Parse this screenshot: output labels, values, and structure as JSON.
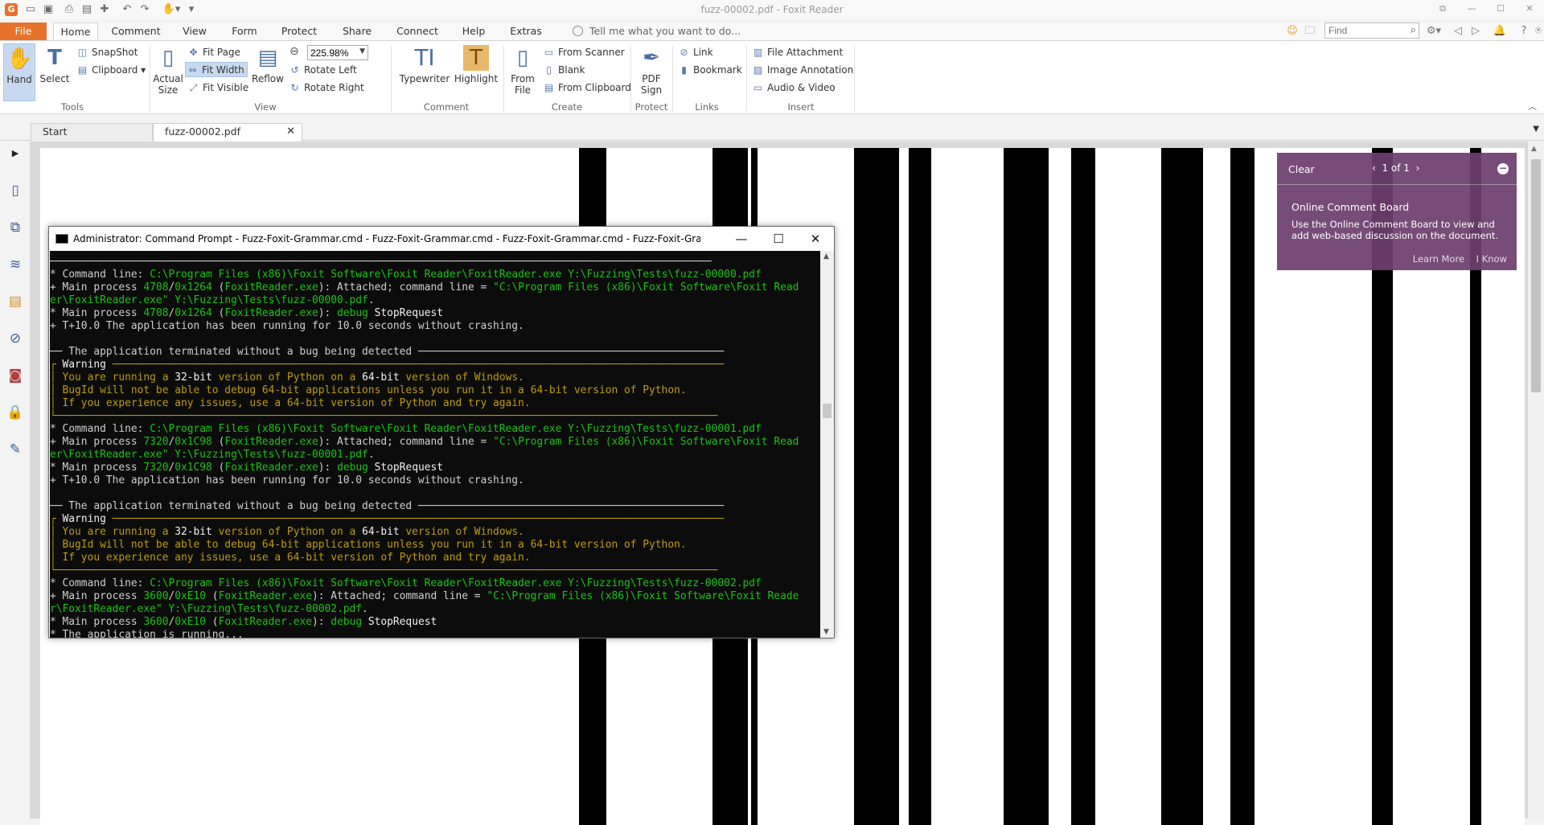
{
  "window": {
    "title": "fuzz-00002.pdf - Foxit Reader",
    "app_logo": "G"
  },
  "menu": {
    "tabs": [
      "File",
      "Home",
      "Comment",
      "View",
      "Form",
      "Protect",
      "Share",
      "Connect",
      "Help",
      "Extras"
    ],
    "tell_me": "Tell me what you want to do...",
    "find_placeholder": "Find"
  },
  "ribbon": {
    "tools": {
      "hand": "Hand",
      "select": "Select",
      "snapshot": "SnapShot",
      "clipboard": "Clipboard",
      "label": "Tools"
    },
    "view": {
      "actual_size_1": "Actual",
      "actual_size_2": "Size",
      "fit_page": "Fit Page",
      "fit_width": "Fit Width",
      "fit_visible": "Fit Visible",
      "reflow": "Reflow",
      "zoom": "225.98%",
      "rotate_left": "Rotate Left",
      "rotate_right": "Rotate Right",
      "label": "View"
    },
    "comment": {
      "typewriter": "Typewriter",
      "highlight": "Highlight",
      "label": "Comment"
    },
    "create": {
      "from_file_1": "From",
      "from_file_2": "File",
      "from_scanner": "From Scanner",
      "blank": "Blank",
      "from_clipboard": "From Clipboard",
      "label": "Create"
    },
    "protect": {
      "pdf_sign_1": "PDF",
      "pdf_sign_2": "Sign",
      "label": "Protect"
    },
    "links": {
      "link": "Link",
      "bookmark": "Bookmark",
      "label": "Links"
    },
    "insert": {
      "file_attachment": "File Attachment",
      "image_annotation": "Image Annotation",
      "audio_video": "Audio & Video",
      "label": "Insert"
    }
  },
  "doc_tabs": [
    "Start",
    "fuzz-00002.pdf"
  ],
  "comment_board": {
    "clear": "Clear",
    "pager": "1 of 1",
    "heading": "Online Comment Board",
    "body": "Use the Online Comment Board to view and add web-based discussion on the document.",
    "learn_more": "Learn More",
    "i_know": "I Know"
  },
  "cmd": {
    "title": "Administrator: Command Prompt - Fuzz-Foxit-Grammar.cmd - Fuzz-Foxit-Grammar.cmd - Fuzz-Foxit-Grammar.cmd - Fuzz-Foxit-Grammar.cmd - Fuzz...",
    "lines": [
      [
        {
          "c": "rule",
          "t": "──────────────────────────────────────────────────────────────────────────────────────────────────────────"
        }
      ],
      [
        {
          "c": "",
          "t": "* Command line: "
        },
        {
          "c": "gr",
          "t": "C:\\Program Files (x86)\\Foxit Software\\Foxit Reader\\FoxitReader.exe Y:\\Fuzzing\\Tests\\fuzz-00000.pdf"
        }
      ],
      [
        {
          "c": "",
          "t": "+ Main process "
        },
        {
          "c": "gr",
          "t": "4708"
        },
        {
          "c": "",
          "t": "/"
        },
        {
          "c": "gr",
          "t": "0x1264"
        },
        {
          "c": "",
          "t": " ("
        },
        {
          "c": "gr",
          "t": "FoxitReader.exe"
        },
        {
          "c": "",
          "t": "): Attached; command line = "
        },
        {
          "c": "gr",
          "t": "\"C:\\Program Files (x86)\\Foxit Software\\Foxit Read"
        }
      ],
      [
        {
          "c": "gr",
          "t": "er\\FoxitReader.exe\" Y:\\Fuzzing\\Tests\\fuzz-00000.pdf"
        },
        {
          "c": "",
          "t": "."
        }
      ],
      [
        {
          "c": "",
          "t": "* Main process "
        },
        {
          "c": "gr",
          "t": "4708"
        },
        {
          "c": "",
          "t": "/"
        },
        {
          "c": "gr",
          "t": "0x1264"
        },
        {
          "c": "",
          "t": " ("
        },
        {
          "c": "gr",
          "t": "FoxitReader.exe"
        },
        {
          "c": "",
          "t": "): "
        },
        {
          "c": "gr",
          "t": "debug"
        },
        {
          "c": "wh",
          "t": " StopRequest"
        }
      ],
      [
        {
          "c": "",
          "t": "+ T+10.0 The application has been running for 10.0 seconds without crashing."
        }
      ],
      [
        {
          "c": "",
          "t": ""
        }
      ],
      [
        {
          "c": "",
          "t": "── The application terminated without a bug being detected ─────────────────────────────────────────────────"
        }
      ],
      [
        {
          "c": "yl",
          "t": "┌ "
        },
        {
          "c": "wh",
          "t": "Warning"
        },
        {
          "c": "yl",
          "t": " ──────────────────────────────────────────────────────────────────────────────────────────────────"
        }
      ],
      [
        {
          "c": "yl",
          "t": "│ You are running a "
        },
        {
          "c": "wh",
          "t": "32-bit"
        },
        {
          "c": "yl",
          "t": " version of Python on a "
        },
        {
          "c": "wh",
          "t": "64-bit"
        },
        {
          "c": "yl",
          "t": " version of Windows."
        }
      ],
      [
        {
          "c": "yl",
          "t": "│ BugId will not be able to debug 64-bit applications unless you run it in a 64-bit version of Python."
        }
      ],
      [
        {
          "c": "yl",
          "t": "│ If you experience any issues, use a 64-bit version of Python and try again."
        }
      ],
      [
        {
          "c": "yl",
          "t": "└──────────────────────────────────────────────────────────────────────────────────────────────────────────"
        }
      ],
      [
        {
          "c": "",
          "t": "* Command line: "
        },
        {
          "c": "gr",
          "t": "C:\\Program Files (x86)\\Foxit Software\\Foxit Reader\\FoxitReader.exe Y:\\Fuzzing\\Tests\\fuzz-00001.pdf"
        }
      ],
      [
        {
          "c": "",
          "t": "+ Main process "
        },
        {
          "c": "gr",
          "t": "7320"
        },
        {
          "c": "",
          "t": "/"
        },
        {
          "c": "gr",
          "t": "0x1C98"
        },
        {
          "c": "",
          "t": " ("
        },
        {
          "c": "gr",
          "t": "FoxitReader.exe"
        },
        {
          "c": "",
          "t": "): Attached; command line = "
        },
        {
          "c": "gr",
          "t": "\"C:\\Program Files (x86)\\Foxit Software\\Foxit Read"
        }
      ],
      [
        {
          "c": "gr",
          "t": "er\\FoxitReader.exe\" Y:\\Fuzzing\\Tests\\fuzz-00001.pdf"
        },
        {
          "c": "",
          "t": "."
        }
      ],
      [
        {
          "c": "",
          "t": "* Main process "
        },
        {
          "c": "gr",
          "t": "7320"
        },
        {
          "c": "",
          "t": "/"
        },
        {
          "c": "gr",
          "t": "0x1C98"
        },
        {
          "c": "",
          "t": " ("
        },
        {
          "c": "gr",
          "t": "FoxitReader.exe"
        },
        {
          "c": "",
          "t": "): "
        },
        {
          "c": "gr",
          "t": "debug"
        },
        {
          "c": "wh",
          "t": " StopRequest"
        }
      ],
      [
        {
          "c": "",
          "t": "+ T+10.0 The application has been running for 10.0 seconds without crashing."
        }
      ],
      [
        {
          "c": "",
          "t": ""
        }
      ],
      [
        {
          "c": "",
          "t": "── The application terminated without a bug being detected ─────────────────────────────────────────────────"
        }
      ],
      [
        {
          "c": "yl",
          "t": "┌ "
        },
        {
          "c": "wh",
          "t": "Warning"
        },
        {
          "c": "yl",
          "t": " ──────────────────────────────────────────────────────────────────────────────────────────────────"
        }
      ],
      [
        {
          "c": "yl",
          "t": "│ You are running a "
        },
        {
          "c": "wh",
          "t": "32-bit"
        },
        {
          "c": "yl",
          "t": " version of Python on a "
        },
        {
          "c": "wh",
          "t": "64-bit"
        },
        {
          "c": "yl",
          "t": " version of Windows."
        }
      ],
      [
        {
          "c": "yl",
          "t": "│ BugId will not be able to debug 64-bit applications unless you run it in a 64-bit version of Python."
        }
      ],
      [
        {
          "c": "yl",
          "t": "│ If you experience any issues, use a 64-bit version of Python and try again."
        }
      ],
      [
        {
          "c": "yl",
          "t": "└──────────────────────────────────────────────────────────────────────────────────────────────────────────"
        }
      ],
      [
        {
          "c": "",
          "t": "* Command line: "
        },
        {
          "c": "gr",
          "t": "C:\\Program Files (x86)\\Foxit Software\\Foxit Reader\\FoxitReader.exe Y:\\Fuzzing\\Tests\\fuzz-00002.pdf"
        }
      ],
      [
        {
          "c": "",
          "t": "+ Main process "
        },
        {
          "c": "gr",
          "t": "3600"
        },
        {
          "c": "",
          "t": "/"
        },
        {
          "c": "gr",
          "t": "0xE10"
        },
        {
          "c": "",
          "t": " ("
        },
        {
          "c": "gr",
          "t": "FoxitReader.exe"
        },
        {
          "c": "",
          "t": "): Attached; command line = "
        },
        {
          "c": "gr",
          "t": "\"C:\\Program Files (x86)\\Foxit Software\\Foxit Reade"
        }
      ],
      [
        {
          "c": "gr",
          "t": "r\\FoxitReader.exe\" Y:\\Fuzzing\\Tests\\fuzz-00002.pdf"
        },
        {
          "c": "",
          "t": "."
        }
      ],
      [
        {
          "c": "",
          "t": "* Main process "
        },
        {
          "c": "gr",
          "t": "3600"
        },
        {
          "c": "",
          "t": "/"
        },
        {
          "c": "gr",
          "t": "0xE10"
        },
        {
          "c": "",
          "t": " ("
        },
        {
          "c": "gr",
          "t": "FoxitReader.exe"
        },
        {
          "c": "",
          "t": "): "
        },
        {
          "c": "gr",
          "t": "debug"
        },
        {
          "c": "wh",
          "t": " StopRequest"
        }
      ],
      [
        {
          "c": "",
          "t": "* The application is running..."
        }
      ]
    ]
  },
  "colors": {
    "file_tab": "#e8722a",
    "selection": "#c7d9f0",
    "comment_board": "#6e3e6e",
    "console_bg": "#0c0c0c",
    "console_green": "#16c60c",
    "console_yellow": "#c19c00"
  },
  "icons": {
    "sidebar": [
      "bookmark-panel-icon",
      "pages-panel-icon",
      "layers-panel-icon",
      "comments-panel-icon",
      "attachments-panel-icon",
      "signatures-panel-icon",
      "security-panel-icon",
      "tool-panel-icon"
    ]
  }
}
